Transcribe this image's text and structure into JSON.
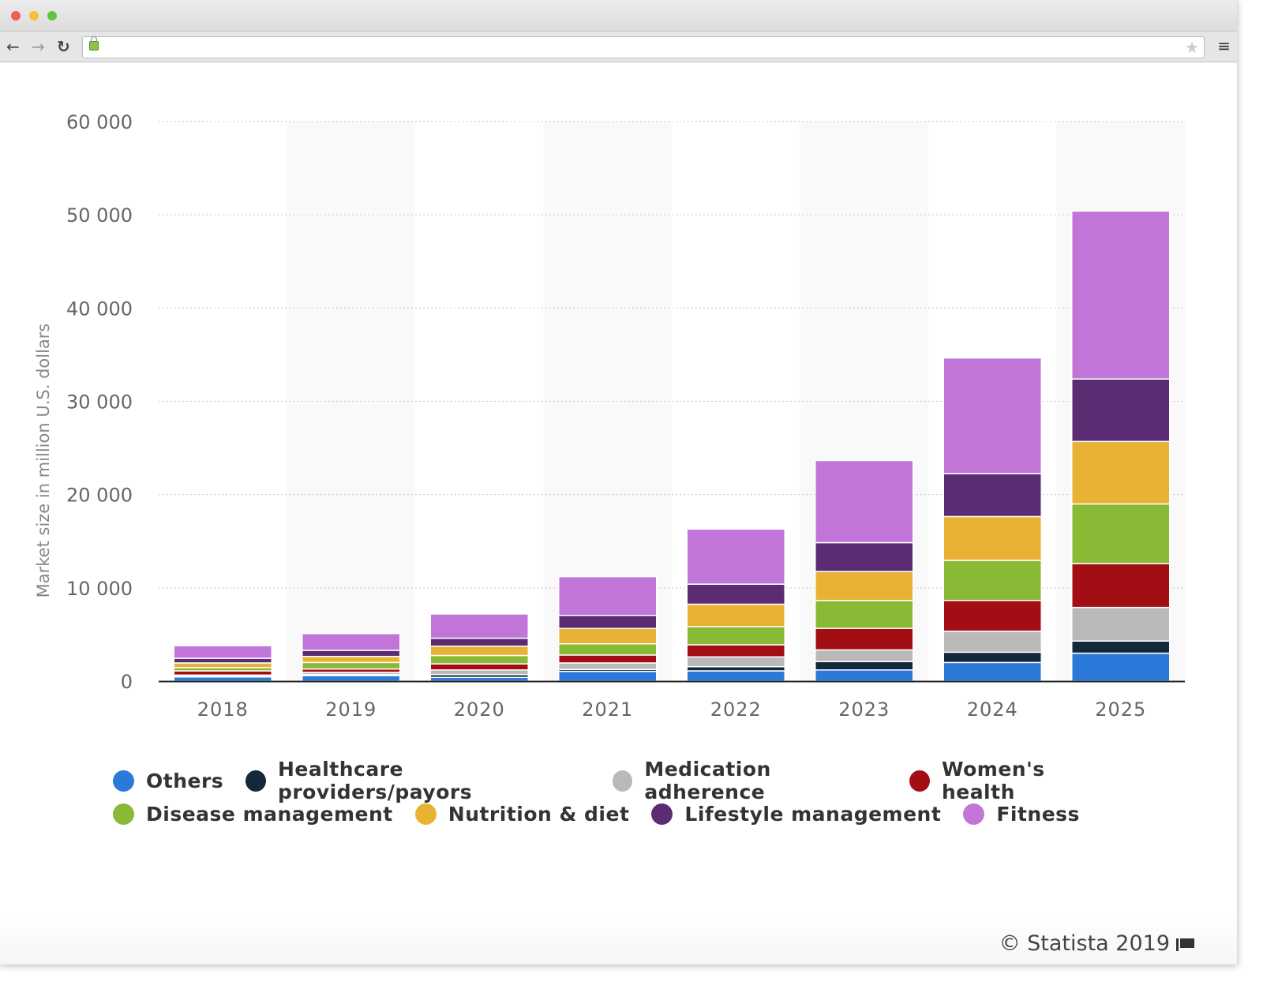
{
  "browser": {
    "back_icon": "←",
    "forward_icon": "→",
    "reload_icon": "↻",
    "star_icon": "★",
    "menu_icon": "≡",
    "url": ""
  },
  "chart_data": {
    "type": "bar",
    "stacked": true,
    "title": "",
    "xlabel": "",
    "ylabel": "Market size in million U.S. dollars",
    "ylim": [
      0,
      60000
    ],
    "yticks": [
      0,
      10000,
      20000,
      30000,
      40000,
      50000,
      60000
    ],
    "ytick_labels": [
      "0",
      "10 000",
      "20 000",
      "30 000",
      "40 000",
      "50 000",
      "60 000"
    ],
    "grid": true,
    "legend_position": "bottom",
    "categories": [
      "2018",
      "2019",
      "2020",
      "2021",
      "2022",
      "2023",
      "2024",
      "2025"
    ],
    "series": [
      {
        "name": "Others",
        "color": "#2b79d8",
        "values": [
          450,
          600,
          400,
          1050,
          1100,
          1200,
          2000,
          3000
        ]
      },
      {
        "name": "Healthcare providers/payors",
        "color": "#13273d",
        "values": [
          50,
          100,
          300,
          200,
          450,
          900,
          1100,
          1300
        ]
      },
      {
        "name": "Medication adherence",
        "color": "#b9b9b9",
        "values": [
          150,
          250,
          500,
          700,
          1050,
          1250,
          2250,
          3600
        ]
      },
      {
        "name": "Women's health",
        "color": "#a30e15",
        "values": [
          450,
          350,
          650,
          850,
          1300,
          2300,
          3300,
          4700
        ]
      },
      {
        "name": "Disease management",
        "color": "#8ab935",
        "values": [
          350,
          700,
          900,
          1200,
          1950,
          3000,
          4300,
          6400
        ]
      },
      {
        "name": "Nutrition & diet",
        "color": "#e9b235",
        "values": [
          500,
          650,
          1000,
          1650,
          2400,
          3100,
          4700,
          6700
        ]
      },
      {
        "name": "Lifestyle management",
        "color": "#5b2c72",
        "values": [
          500,
          650,
          850,
          1400,
          2150,
          3100,
          4600,
          6700
        ]
      },
      {
        "name": "Fitness",
        "color": "#c175d8",
        "values": [
          1350,
          1800,
          2600,
          4150,
          5900,
          8800,
          12400,
          18000
        ]
      }
    ]
  },
  "legend": {
    "rows": [
      [
        0,
        1,
        2,
        3
      ],
      [
        4,
        5,
        6,
        7
      ]
    ]
  },
  "credit": "© Statista 2019"
}
